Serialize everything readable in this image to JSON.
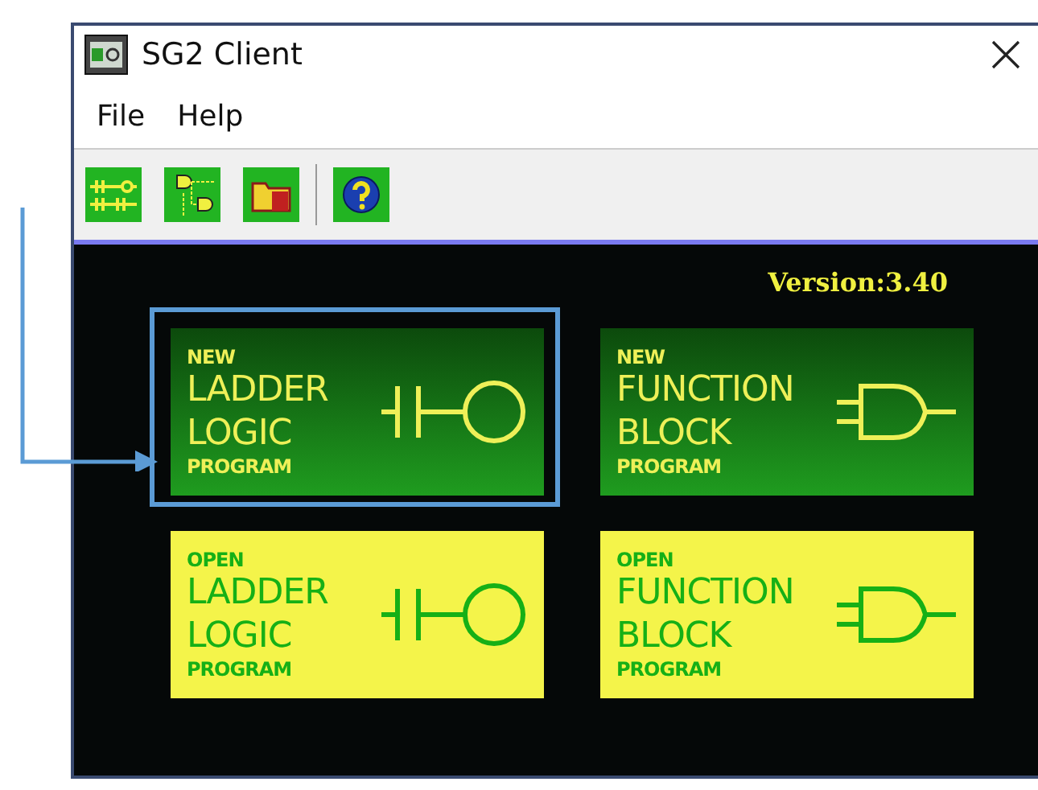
{
  "window": {
    "title": "SG2 Client"
  },
  "menu": [
    "File",
    "Help"
  ],
  "toolbar": [
    {
      "kind": "ladder"
    },
    {
      "kind": "function"
    },
    {
      "kind": "open"
    },
    {
      "kind": "separator"
    },
    {
      "kind": "help"
    }
  ],
  "version": "Version:3.40",
  "cards": [
    {
      "kind": "new",
      "prefix": "NEW",
      "lines": [
        "LADDER",
        "LOGIC"
      ],
      "suffix": "PROGRAM",
      "highlighted": true
    },
    {
      "kind": "new",
      "prefix": "NEW",
      "lines": [
        "FUNCTION",
        "BLOCK"
      ],
      "suffix": "PROGRAM",
      "highlighted": false
    },
    {
      "kind": "open",
      "prefix": "OPEN",
      "lines": [
        "LADDER",
        "LOGIC"
      ],
      "suffix": "PROGRAM",
      "highlighted": false
    },
    {
      "kind": "open",
      "prefix": "OPEN",
      "lines": [
        "FUNCTION",
        "BLOCK"
      ],
      "suffix": "PROGRAM",
      "highlighted": false
    }
  ]
}
